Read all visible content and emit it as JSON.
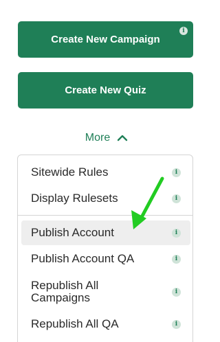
{
  "buttons": {
    "create_campaign": "Create New Campaign",
    "create_quiz": "Create New Quiz",
    "info_glyph": "i"
  },
  "more": {
    "label": "More",
    "icon": "chevron-up-icon"
  },
  "menu": {
    "items": [
      {
        "label": "Sitewide Rules",
        "icon": "info-icon"
      },
      {
        "label": "Display Rulesets",
        "icon": "info-icon"
      },
      {
        "label": "Publish Account",
        "icon": "info-icon",
        "highlighted": true
      },
      {
        "label": "Publish Account QA",
        "icon": "info-icon"
      },
      {
        "label": "Republish All Campaigns",
        "icon": "info-icon"
      },
      {
        "label": "Republish All QA",
        "icon": "info-icon"
      }
    ]
  },
  "annotation": {
    "icon": "green-arrow-icon",
    "color": "#22cc22"
  },
  "colors": {
    "brand_green": "#1f7f57",
    "hover_gray": "#eeeeee"
  }
}
